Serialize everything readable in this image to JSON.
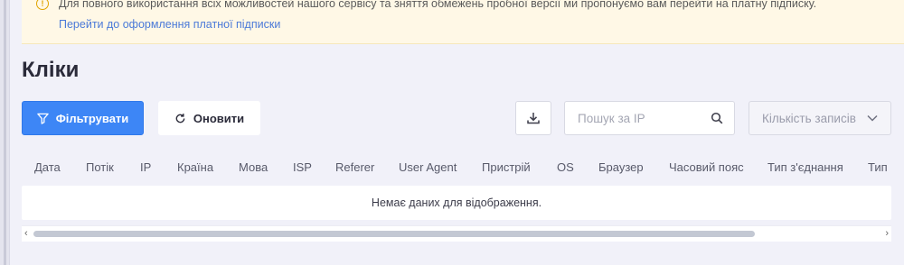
{
  "notice": {
    "message": "Для повного використання всіх можливостей нашого сервісу та зняття обмежень пробної версії ми пропонуємо вам перейти на платну підписку.",
    "link": "Перейти до оформлення платної підписки",
    "icon": "warning-icon"
  },
  "page": {
    "title": "Кліки"
  },
  "toolbar": {
    "filter_label": "Фільтрувати",
    "refresh_label": "Оновити",
    "search_placeholder": "Пошук за IP",
    "records_select": "Кількість записів",
    "accent_color": "#3d86f6"
  },
  "table": {
    "columns": [
      "Дата",
      "Потік",
      "IP",
      "Країна",
      "Мова",
      "ISP",
      "Referer",
      "User Agent",
      "Пристрій",
      "OS",
      "Браузер",
      "Часовий пояс",
      "Тип з'єднання",
      "Тип"
    ],
    "empty_text": "Немає даних для відображення."
  }
}
